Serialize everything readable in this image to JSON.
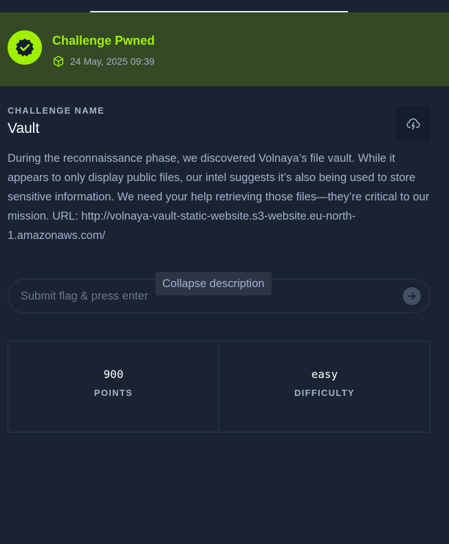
{
  "banner": {
    "title": "Challenge Pwned",
    "date": "24 May, 2025 09:39",
    "badge_icon": "checkmark-badge-icon",
    "meta_icon": "cube-icon",
    "accent_color": "#9fef00"
  },
  "challenge": {
    "section_label": "CHALLENGE NAME",
    "name": "Vault",
    "download_icon": "cloud-download-icon",
    "description": "During the reconnaissance phase, we discovered Volnaya’s file vault. While it appears to only display public files, our intel suggests it’s also being used to store sensitive information. We need your help retrieving those files—they’re critical to our mission. URL: http://volnaya-vault-static-website.s3-website.eu-north-1.amazonaws.com/"
  },
  "flag": {
    "placeholder": "Submit flag & press enter",
    "value": "",
    "submit_icon": "arrow-right-icon"
  },
  "tooltip": {
    "text": "Collapse description"
  },
  "stats": {
    "points": {
      "value": "900",
      "label": "POINTS"
    },
    "difficulty": {
      "value": "easy",
      "label": "DIFFICULTY"
    }
  }
}
